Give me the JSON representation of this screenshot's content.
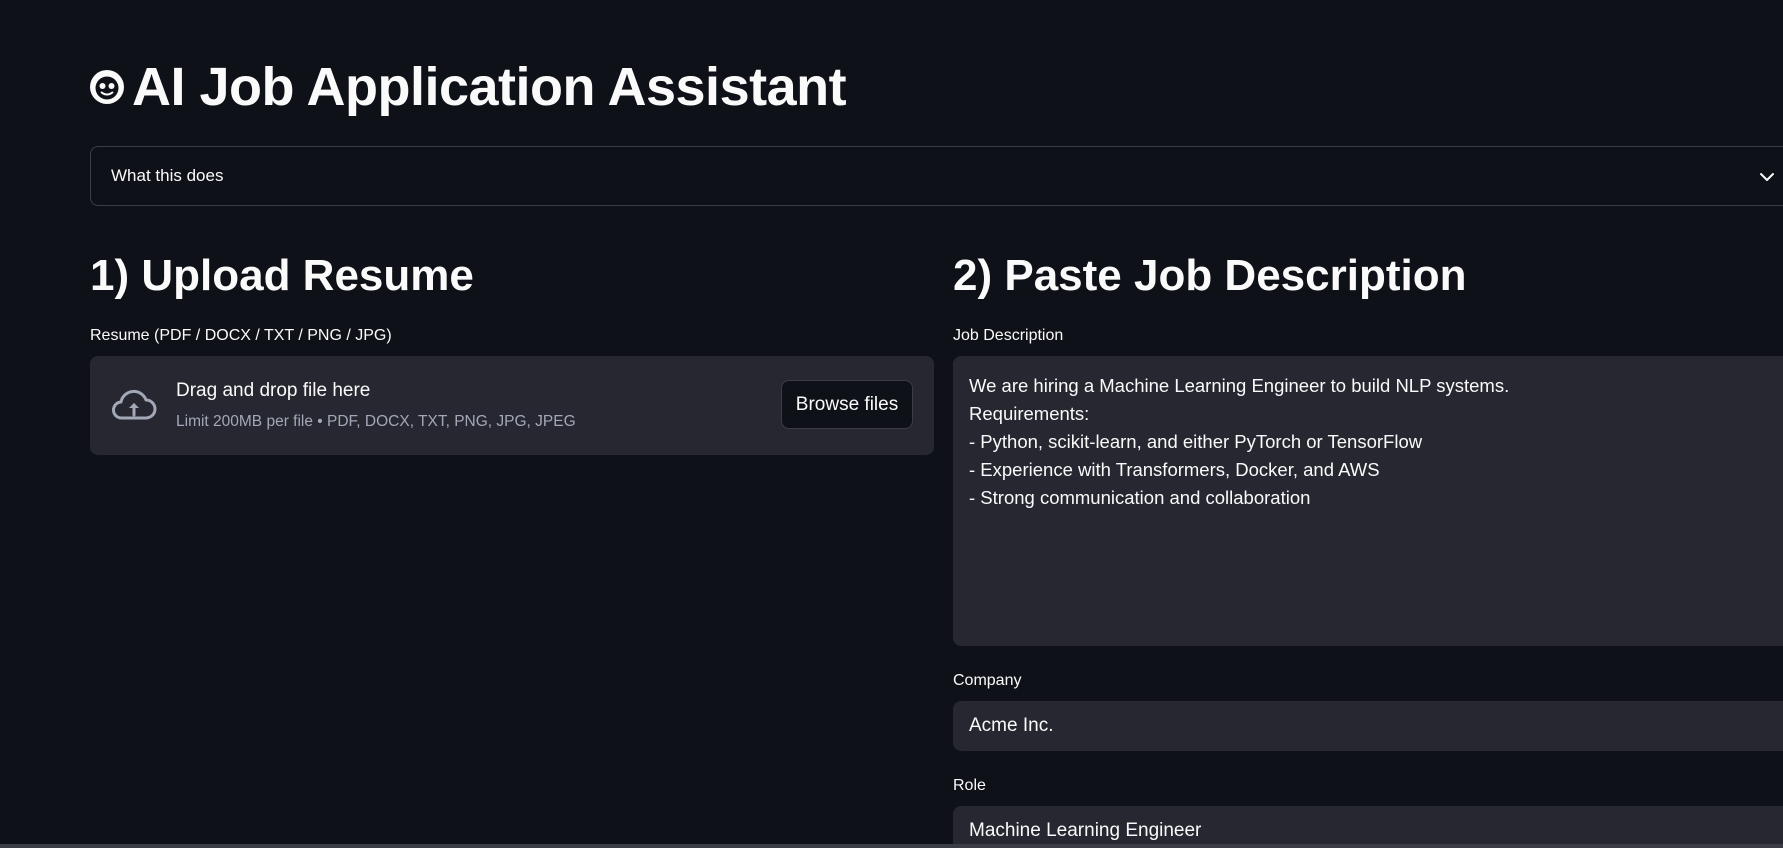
{
  "header": {
    "title": "AI Job Application Assistant",
    "icon": "robot-icon"
  },
  "expander": {
    "label": "What this does",
    "icon": "chevron-down-icon"
  },
  "resume_section": {
    "heading": "1) Upload Resume",
    "field_label": "Resume (PDF / DOCX / TXT / PNG / JPG)",
    "uploader": {
      "icon": "cloud-upload-icon",
      "drop_text": "Drag and drop file here",
      "limit_text": "Limit 200MB per file • PDF, DOCX, TXT, PNG, JPG, JPEG",
      "browse_label": "Browse files"
    }
  },
  "job_section": {
    "heading": "2) Paste Job Description",
    "description_label": "Job Description",
    "description_lines": [
      "We are hiring a Machine Learning Engineer to build NLP systems.",
      "Requirements:",
      "- Python, scikit-learn, and either PyTorch or TensorFlow",
      "- Experience with Transformers, Docker, and AWS",
      "- Strong communication and collaboration"
    ],
    "company_label": "Company",
    "company_value": "Acme Inc.",
    "role_label": "Role",
    "role_value": "Machine Learning Engineer"
  },
  "colors": {
    "background": "#0e1117",
    "surface": "#262730",
    "border": "#3a3d46",
    "text": "#fafafa",
    "muted_text": "#a3a8b8"
  }
}
